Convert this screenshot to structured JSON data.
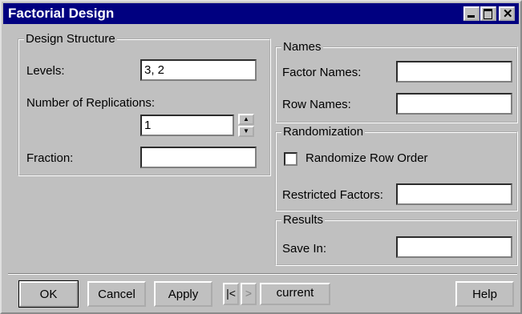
{
  "window": {
    "title": "Factorial Design"
  },
  "design_structure": {
    "legend": "Design Structure",
    "levels": {
      "label": "Levels:",
      "value": "3, 2"
    },
    "replications": {
      "label": "Number of Replications:",
      "value": "1"
    },
    "fraction": {
      "label": "Fraction:",
      "value": ""
    }
  },
  "names": {
    "legend": "Names",
    "factor_names": {
      "label": "Factor Names:",
      "value": ""
    },
    "row_names": {
      "label": "Row Names:",
      "value": ""
    }
  },
  "randomization": {
    "legend": "Randomization",
    "randomize_row_order": {
      "label": "Randomize Row Order",
      "checked": false
    },
    "restricted_factors": {
      "label": "Restricted Factors:",
      "value": ""
    }
  },
  "results": {
    "legend": "Results",
    "save_in": {
      "label": "Save In:",
      "value": ""
    }
  },
  "buttons": {
    "ok": "OK",
    "cancel": "Cancel",
    "apply": "Apply",
    "current": "current",
    "help": "Help"
  },
  "icons": {
    "minimize": "minimize-icon",
    "maximize": "maximize-icon",
    "close": "close-icon",
    "first": "first-page-icon",
    "next": "next-page-icon",
    "spin_up": "spin-up-icon",
    "spin_down": "spin-down-icon"
  }
}
